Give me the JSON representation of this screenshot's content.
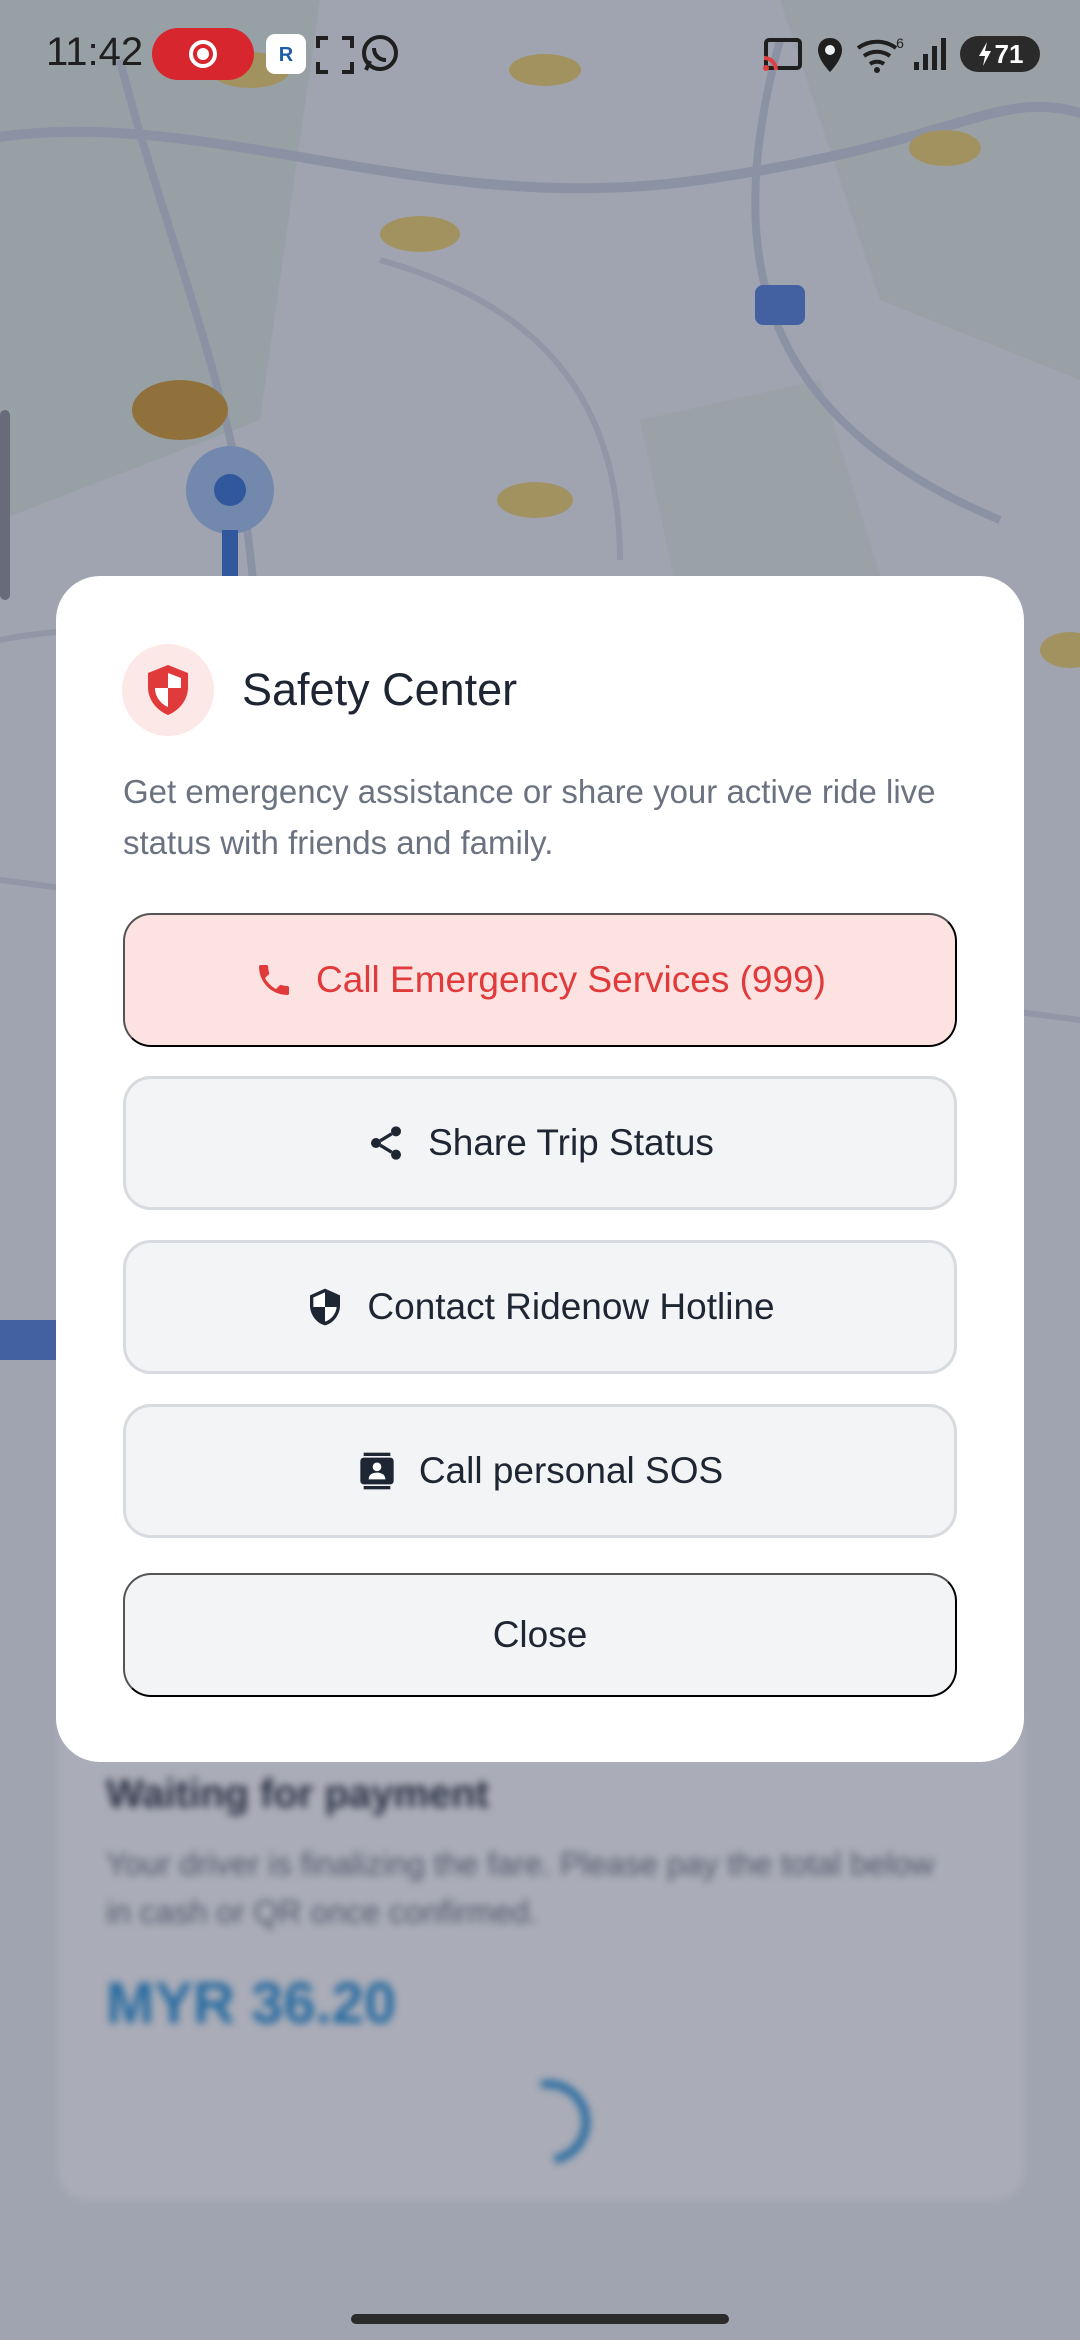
{
  "status_bar": {
    "time": "11:42",
    "battery": "71",
    "icons": [
      "screen-record-icon",
      "ridenow-app-icon",
      "screenshot-icon",
      "whatsapp-icon",
      "cast-icon",
      "location-icon",
      "wifi-icon",
      "signal-icon",
      "battery-icon"
    ]
  },
  "background": {
    "card_title": "Waiting for payment",
    "card_desc": "Your driver is finalizing the fare. Please pay the total below in cash or QR once confirmed.",
    "amount": "MYR 36.20"
  },
  "dialog": {
    "title": "Safety Center",
    "description": "Get emergency assistance or share your active ride live status with friends and family.",
    "buttons": {
      "emergency": "Call Emergency Services (999)",
      "share": "Share Trip Status",
      "hotline": "Contact Ridenow Hotline",
      "sos": "Call personal SOS",
      "close": "Close"
    }
  },
  "colors": {
    "danger": "#e03a3a",
    "danger_bg": "#fde2e2",
    "text": "#1f2633",
    "muted": "#6b7280",
    "map_accent": "#1d8fd8"
  }
}
